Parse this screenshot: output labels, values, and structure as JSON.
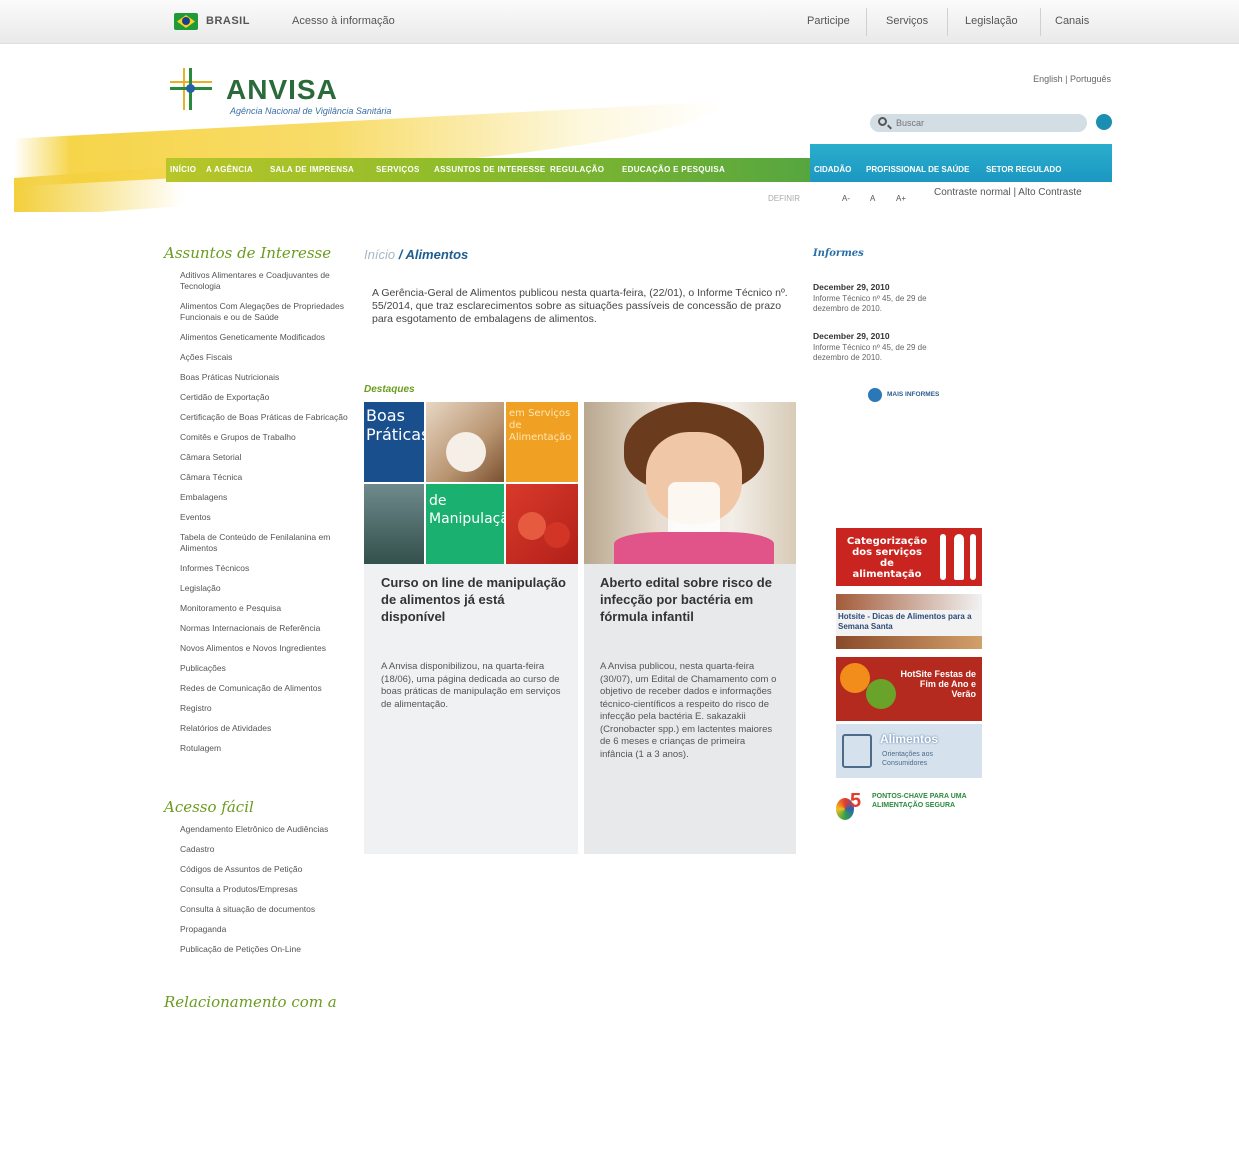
{
  "govbar": {
    "brasil": "BRASIL",
    "acesso": "Acesso à informação",
    "links": [
      "Participe",
      "Serviços",
      "Legislação",
      "Canais"
    ]
  },
  "header": {
    "brand": "ANVISA",
    "brand_sub": "Agência Nacional de Vigilância Sanitária",
    "langs": "English | Português",
    "search_placeholder": "Buscar",
    "nav_green": [
      "INÍCIO",
      "A AGÊNCIA",
      "SALA DE IMPRENSA",
      "SERVIÇOS",
      "ASSUNTOS DE INTERESSE",
      "REGULAÇÃO",
      "EDUCAÇÃO E PESQUISA"
    ],
    "nav_blue": [
      "CIDADÃO",
      "PROFISSIONAL DE SAÚDE",
      "SETOR REGULADO"
    ],
    "fontsize": [
      "DEFINIR",
      "A-",
      "A",
      "A+"
    ],
    "contraste": "Contraste normal | Alto Contraste"
  },
  "left": {
    "assuntos_title": "Assuntos de Interesse",
    "assuntos": [
      "Aditivos Alimentares e Coadjuvantes de Tecnologia",
      "Alimentos Com Alegações de Propriedades Funcionais e ou de Saúde",
      "Alimentos Geneticamente Modificados",
      "Ações Fiscais",
      "Boas Práticas Nutricionais",
      "Certidão de Exportação",
      "Certificação de Boas Práticas de Fabricação",
      "Comitês e Grupos de Trabalho",
      "Câmara Setorial",
      "Câmara Técnica",
      "Embalagens",
      "Eventos",
      "Tabela de Conteúdo de Fenilalanina em Alimentos",
      "Informes Técnicos",
      "Legislação",
      "Monitoramento e Pesquisa",
      "Normas Internacionais de Referência",
      "Novos Alimentos e Novos Ingredientes",
      "Publicações",
      "Redes de Comunicação de Alimentos",
      "Registro",
      "Relatórios de Atividades",
      "Rotulagem"
    ],
    "acesso_title": "Acesso fácil",
    "acesso": [
      "Agendamento Eletrônico de Audiências",
      "Cadastro",
      "Códigos de Assuntos de Petição",
      "Consulta a Produtos/Empresas",
      "Consulta à situação de documentos",
      "Propaganda",
      "Publicação de Petições On-Line"
    ],
    "relacionamento_title": "Relacionamento com a"
  },
  "main": {
    "crumb_home": "Início",
    "crumb_sep": " / ",
    "crumb_current": "Alimentos",
    "intro": "A Gerência-Geral de Alimentos publicou nesta quarta-feira, (22/01), o Informe Técnico nº. 55/2014, que traz esclarecimentos sobre as situações passíveis de concessão de prazo para esgotamento de embalagens de alimentos.",
    "destaques": "Destaques",
    "tile_boas": "Boas Práticas",
    "tile_servicos": "em Serviços de Alimentação",
    "tile_manip": "de Manipulação",
    "card1_title": "Curso on line de manipulação de alimentos já está disponível",
    "card1_text": "A Anvisa disponibilizou, na quarta-feira (18/06), uma página dedicada ao curso de boas práticas de manipulação em serviços de alimentação.",
    "card2_title": "Aberto edital sobre risco de infecção por bactéria em fórmula infantil",
    "card2_text": "A Anvisa publicou, nesta quarta-feira (30/07), um Edital de Chamamento com o objetivo de receber dados e informações técnico-científicos a respeito do risco de infecção pela bactéria E. sakazakii (Cronobacter spp.) em lactentes maiores de 6 meses e crianças de primeira infância (1 a 3 anos)."
  },
  "right": {
    "title": "Informes",
    "items": [
      {
        "date": "December 29, 2010",
        "text": "Informe Técnico nº 45, de 29 de dezembro de 2010."
      },
      {
        "date": "December 29, 2010",
        "text": "Informe Técnico nº 45, de 29 de dezembro de 2010."
      }
    ],
    "mais": "MAIS INFORMES",
    "banner1": "Categorização dos serviços de alimentação",
    "banner2": "Hotsite - Dicas de Alimentos para a Semana Santa",
    "banner3": "HotSite Festas de Fim de Ano e Verão",
    "banner4_title": "Alimentos",
    "banner4_sub": "Orientações aos Consumidores",
    "banner5_num": "5",
    "banner5_text": "PONTOS-CHAVE PARA UMA ALIMENTAÇÃO SEGURA"
  }
}
